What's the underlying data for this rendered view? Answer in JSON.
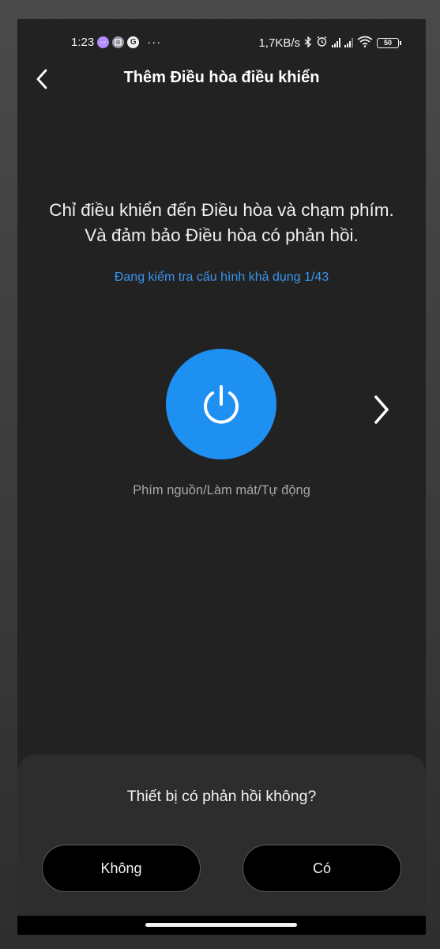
{
  "status_bar": {
    "time": "1:23",
    "app_icons": [
      "messenger-icon",
      "gallery-icon",
      "google-icon"
    ],
    "google_letter": "G",
    "more": "···",
    "network_speed": "1,7KB/s",
    "battery": "50"
  },
  "header": {
    "title": "Thêm Điều hòa điều khiển"
  },
  "instruction": {
    "line1": "Chỉ điều khiển đến Điều hòa và chạm phím.",
    "line2": "Và đảm bảo Điều hòa có phản hồi."
  },
  "checking_status": "Đang kiểm tra cấu hình khả dụng 1/43",
  "key_label": "Phím nguồn/Làm mát/Tự động",
  "sheet": {
    "question": "Thiết bị có phản hồi không?",
    "no_label": "Không",
    "yes_label": "Có"
  },
  "colors": {
    "accent": "#1e90f2",
    "link": "#3b95f0",
    "background": "#222222"
  }
}
